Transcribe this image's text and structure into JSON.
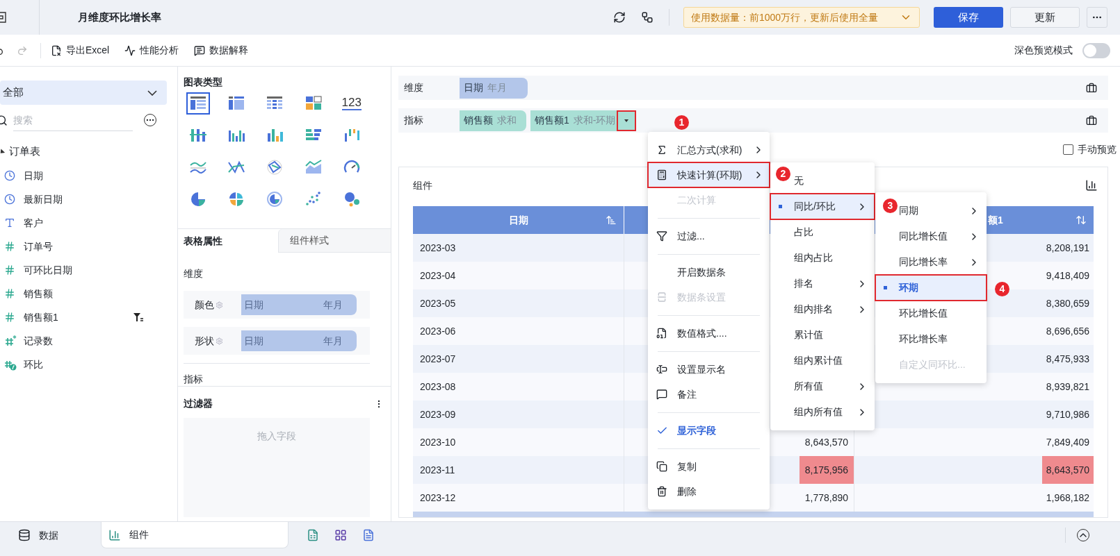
{
  "app_bar": {
    "title": "月维度环比增长率",
    "data_notice": "使用数据量：前1000万行，更新后使用全量",
    "buttons": [
      "保存",
      "更新"
    ]
  },
  "toolbar": {
    "actions": [
      "导出Excel",
      "性能分析",
      "数据解释"
    ],
    "dark_preview": {
      "label": "深色预览模式",
      "on": false
    }
  },
  "data_panel": {
    "scope": "全部",
    "search_placeholder": "搜索",
    "table": {
      "name": "订单表",
      "expanded": true,
      "children": [
        {
          "name": "日期",
          "kind": "date",
          "filtered": false
        },
        {
          "name": "最新日期",
          "kind": "date",
          "filtered": false
        },
        {
          "name": "客户",
          "kind": "text",
          "filtered": false
        },
        {
          "name": "订单号",
          "kind": "number",
          "filtered": false
        },
        {
          "name": "可环比日期",
          "kind": "number",
          "filtered": false
        },
        {
          "name": "销售额",
          "kind": "number",
          "filtered": false
        },
        {
          "name": "销售额1",
          "kind": "number",
          "filtered": true
        },
        {
          "name": "记录数",
          "kind": "calculated",
          "filtered": false
        },
        {
          "name": "环比",
          "kind": "formula",
          "filtered": false
        }
      ]
    }
  },
  "chart_panel": {
    "title": "图表类型",
    "chart_types": [
      {
        "selected": true
      },
      {
        "selected": false
      },
      {
        "selected": false
      },
      {
        "selected": false
      },
      {
        "selected": false,
        "label": "123"
      },
      {
        "selected": false
      },
      {
        "selected": false
      },
      {
        "selected": false
      },
      {
        "selected": false
      },
      {
        "selected": false
      },
      {
        "selected": false
      },
      {
        "selected": false
      },
      {
        "selected": false
      },
      {
        "selected": false
      },
      {
        "selected": false
      },
      {
        "selected": false
      },
      {
        "selected": false
      },
      {
        "selected": false
      },
      {
        "selected": false
      },
      {
        "selected": false
      }
    ],
    "tabs": [
      {
        "label": "表格属性",
        "selected": true
      },
      {
        "label": "组件样式",
        "selected": false
      }
    ],
    "dimension_title": "维度",
    "encodings": [
      {
        "label": "颜色",
        "field": "日期",
        "unit": "年月"
      },
      {
        "label": "形状",
        "field": "日期",
        "unit": "年月"
      }
    ],
    "measure_title": "指标",
    "filter": {
      "title": "过滤器",
      "drop_hint": "拖入字段"
    }
  },
  "editor": {
    "dimension": {
      "label": "维度",
      "pills": [
        {
          "field": "日期",
          "agg": "年月",
          "menu_open": false
        }
      ]
    },
    "measure": {
      "label": "指标",
      "pills": [
        {
          "field": "销售额",
          "agg": "求和",
          "menu_open": false
        },
        {
          "field": "销售额1",
          "agg": "求和-环期",
          "menu_open": true
        }
      ]
    },
    "manual_preview": {
      "label": "手动预览",
      "checked": false
    },
    "widget": {
      "title": "组件",
      "headers": {
        "column_1": "日期",
        "column_3": "额1"
      },
      "rows": [
        {
          "date": "2023-03",
          "column_3": {
            "text": "8,208,191",
            "alert": false
          }
        },
        {
          "date": "2023-04",
          "column_3": {
            "text": "9,418,409",
            "alert": false
          }
        },
        {
          "date": "2023-05",
          "column_3": {
            "text": "8,380,659",
            "alert": false
          }
        },
        {
          "date": "2023-06",
          "column_3": {
            "text": "8,696,656",
            "alert": false
          }
        },
        {
          "date": "2023-07",
          "column_3": {
            "text": "8,475,933",
            "alert": false
          }
        },
        {
          "date": "2023-08",
          "column_3": {
            "text": "8,939,821",
            "alert": false
          }
        },
        {
          "date": "2023-09",
          "column_3": {
            "text": "9,710,986",
            "alert": false
          }
        },
        {
          "date": "2023-10",
          "column_2": {
            "text": "8,643,570",
            "alert": false
          },
          "column_3": {
            "text": "7,849,409",
            "alert": false
          }
        },
        {
          "date": "2023-11",
          "column_2": {
            "text": "8,175,956",
            "alert": true
          },
          "column_3": {
            "text": "8,643,570",
            "alert": true
          }
        },
        {
          "date": "2023-12",
          "column_2": {
            "text": "1,778,890",
            "alert": false
          },
          "column_3": {
            "text": "1,968,182",
            "alert": false
          }
        }
      ]
    }
  },
  "field_menu": {
    "items": [
      {
        "kind": "item",
        "label": "汇总方式(求和)",
        "submenu": true,
        "disabled": false,
        "selected": false,
        "outlined": false,
        "checked": false
      },
      {
        "kind": "item",
        "label": "快速计算(环期)",
        "submenu": true,
        "disabled": false,
        "selected": true,
        "outlined": true,
        "checked": false
      },
      {
        "kind": "item",
        "label": "二次计算",
        "submenu": false,
        "disabled": true,
        "selected": false,
        "outlined": false,
        "checked": false
      },
      {
        "kind": "divider"
      },
      {
        "kind": "item",
        "label": "过滤...",
        "submenu": false,
        "disabled": false,
        "selected": false,
        "outlined": false,
        "checked": false
      },
      {
        "kind": "divider"
      },
      {
        "kind": "item",
        "label": "开启数据条",
        "submenu": false,
        "disabled": false,
        "selected": false,
        "outlined": false,
        "checked": false
      },
      {
        "kind": "item",
        "label": "数据条设置",
        "submenu": false,
        "disabled": true,
        "selected": false,
        "outlined": false,
        "checked": false
      },
      {
        "kind": "divider"
      },
      {
        "kind": "item",
        "label": "数值格式....",
        "submenu": false,
        "disabled": false,
        "selected": false,
        "outlined": false,
        "checked": false
      },
      {
        "kind": "divider"
      },
      {
        "kind": "item",
        "label": "设置显示名",
        "submenu": false,
        "disabled": false,
        "selected": false,
        "outlined": false,
        "checked": false
      },
      {
        "kind": "item",
        "label": "备注",
        "submenu": false,
        "disabled": false,
        "selected": false,
        "outlined": false,
        "checked": false
      },
      {
        "kind": "divider"
      },
      {
        "kind": "item",
        "label": "显示字段",
        "submenu": false,
        "disabled": false,
        "selected": false,
        "outlined": false,
        "checked": true
      },
      {
        "kind": "divider"
      },
      {
        "kind": "item",
        "label": "复制",
        "submenu": false,
        "disabled": false,
        "selected": false,
        "outlined": false,
        "checked": false
      },
      {
        "kind": "item",
        "label": "删除",
        "submenu": false,
        "disabled": false,
        "selected": false,
        "outlined": false,
        "checked": false
      }
    ]
  },
  "quick_calc_menu": {
    "items": [
      {
        "label": "无",
        "submenu": false,
        "disabled": false,
        "selected": false,
        "outlined": false
      },
      {
        "label": "同比/环比",
        "submenu": true,
        "disabled": false,
        "selected": true,
        "outlined": true
      },
      {
        "label": "占比",
        "submenu": false,
        "disabled": false,
        "selected": false,
        "outlined": false
      },
      {
        "label": "组内占比",
        "submenu": false,
        "disabled": false,
        "selected": false,
        "outlined": false
      },
      {
        "label": "排名",
        "submenu": true,
        "disabled": false,
        "selected": false,
        "outlined": false
      },
      {
        "label": "组内排名",
        "submenu": true,
        "disabled": false,
        "selected": false,
        "outlined": false
      },
      {
        "label": "累计值",
        "submenu": false,
        "disabled": false,
        "selected": false,
        "outlined": false
      },
      {
        "label": "组内累计值",
        "submenu": false,
        "disabled": false,
        "selected": false,
        "outlined": false
      },
      {
        "label": "所有值",
        "submenu": true,
        "disabled": false,
        "selected": false,
        "outlined": false
      },
      {
        "label": "组内所有值",
        "submenu": true,
        "disabled": false,
        "selected": false,
        "outlined": false
      }
    ]
  },
  "compare_menu": {
    "items": [
      {
        "label": "同期",
        "submenu": true,
        "disabled": false,
        "selected": false,
        "outlined": false
      },
      {
        "label": "同比增长值",
        "submenu": true,
        "disabled": false,
        "selected": false,
        "outlined": false
      },
      {
        "label": "同比增长率",
        "submenu": true,
        "disabled": false,
        "selected": false,
        "outlined": false
      },
      {
        "label": "环期",
        "submenu": false,
        "disabled": false,
        "selected": true,
        "outlined": true
      },
      {
        "label": "环比增长值",
        "submenu": false,
        "disabled": false,
        "selected": false,
        "outlined": false
      },
      {
        "label": "环比增长率",
        "submenu": false,
        "disabled": false,
        "selected": false,
        "outlined": false
      },
      {
        "label": "自定义同环比...",
        "submenu": false,
        "disabled": true,
        "selected": false,
        "outlined": false
      }
    ]
  },
  "step_badges": [
    {
      "number": "1"
    },
    {
      "number": "2"
    },
    {
      "number": "3"
    },
    {
      "number": "4"
    }
  ],
  "bottom_bar": {
    "tabs": [
      {
        "label": "数据",
        "selected": false
      },
      {
        "label": "组件",
        "selected": true
      }
    ]
  }
}
